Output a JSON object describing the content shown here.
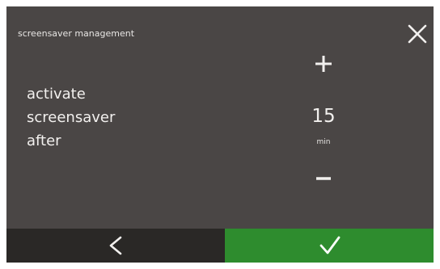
{
  "header": {
    "title": "screensaver management"
  },
  "setting": {
    "label_lines": [
      "activate",
      "screensaver",
      "after"
    ],
    "value": "15",
    "unit": "min"
  },
  "icons": {
    "close": "close-icon",
    "increase": "plus-icon",
    "decrease": "minus-icon",
    "back": "chevron-left-icon",
    "confirm": "checkmark-icon"
  },
  "colors": {
    "background": "#4a4645",
    "back_button": "#2a2826",
    "confirm_button": "#2e8c2e",
    "text": "#f2f0ee"
  }
}
